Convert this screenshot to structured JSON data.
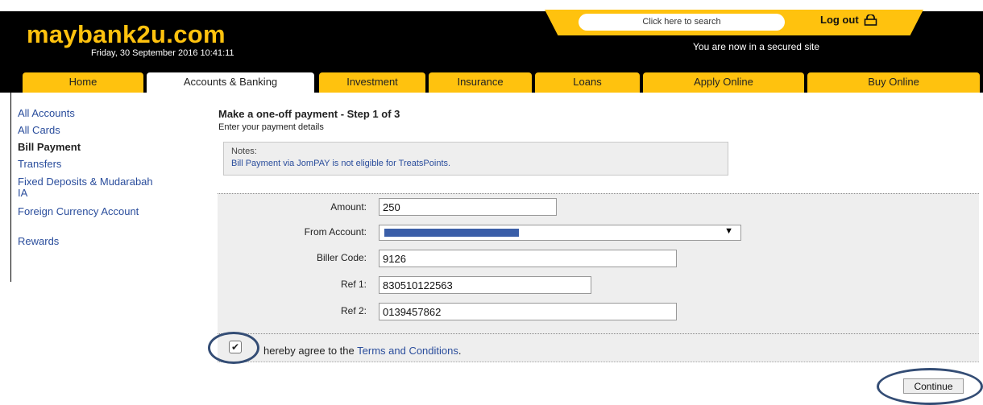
{
  "header": {
    "logo": "maybank2u.com",
    "date": "Friday, 30 September 2016 10:41:11",
    "search_label": "Click here to search",
    "logout_label": "Log out",
    "secured_text": "You are now in a secured site"
  },
  "tabs": [
    {
      "label": "Home"
    },
    {
      "label": "Accounts & Banking"
    },
    {
      "label": "Investment"
    },
    {
      "label": "Insurance"
    },
    {
      "label": "Loans"
    },
    {
      "label": "Apply Online"
    },
    {
      "label": "Buy Online"
    }
  ],
  "sidebar": {
    "items": [
      {
        "label": "All Accounts"
      },
      {
        "label": "All Cards"
      },
      {
        "label": "Bill Payment"
      },
      {
        "label": "Transfers"
      },
      {
        "label": "Fixed Deposits & Mudarabah IA"
      },
      {
        "label": "Foreign Currency Account"
      },
      {
        "label": "Rewards"
      }
    ]
  },
  "main": {
    "title": "Make a one-off payment - Step 1 of 3",
    "subtitle": "Enter your payment details",
    "notes_label": "Notes:",
    "notes_text": "Bill Payment via JomPAY is not eligible for TreatsPoints.",
    "form": {
      "amount_label": "Amount:",
      "amount_value": "250",
      "from_account_label": "From Account:",
      "biller_code_label": "Biller Code:",
      "biller_code_value": "9126",
      "ref1_label": "Ref 1:",
      "ref1_value": "830510122563",
      "ref2_label": "Ref 2:",
      "ref2_value": "0139457862"
    },
    "agree_text": "hereby agree to the",
    "terms_link": "Terms and Conditions",
    "agree_end": ".",
    "continue_label": "Continue"
  },
  "colors": {
    "brand_yellow": "#ffc20e",
    "header_black": "#000000",
    "link_blue": "#2a4d9c",
    "highlight_ring": "#344d75"
  }
}
